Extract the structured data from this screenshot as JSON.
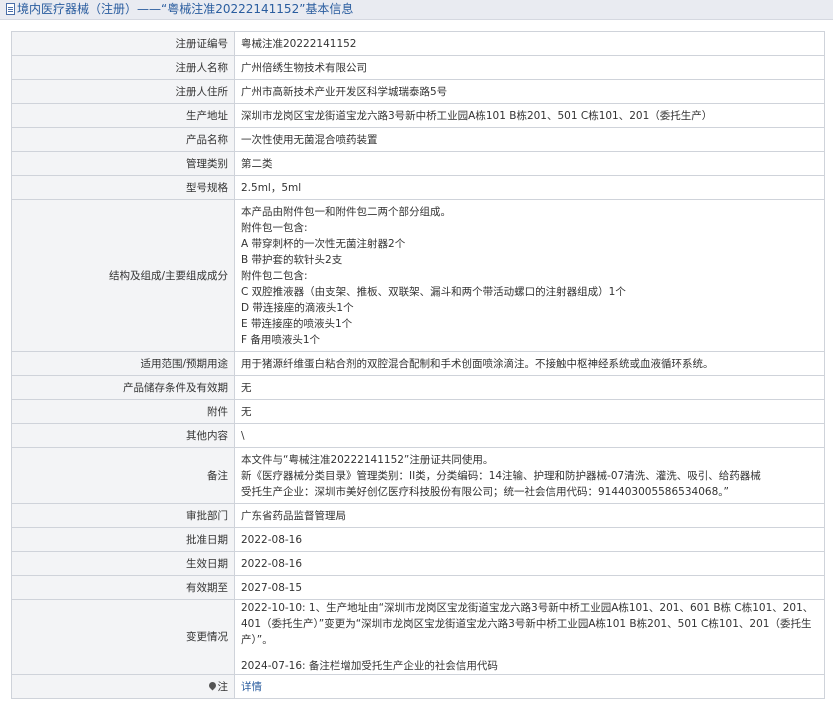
{
  "header": {
    "title": "境内医疗器械（注册）——“粤械注准20222141152”基本信息",
    "icon": "document-icon"
  },
  "rows": [
    {
      "label": "注册证编号",
      "value": "粤械注准20222141152"
    },
    {
      "label": "注册人名称",
      "value": "广州倍绣生物技术有限公司"
    },
    {
      "label": "注册人住所",
      "value": "广州市高新技术产业开发区科学城瑞泰路5号"
    },
    {
      "label": "生产地址",
      "value": "深圳市龙岗区宝龙街道宝龙六路3号新中桥工业园A栋101 B栋201、501 C栋101、201（委托生产）"
    },
    {
      "label": "产品名称",
      "value": "一次性使用无菌混合喷药装置"
    },
    {
      "label": "管理类别",
      "value": "第二类"
    },
    {
      "label": "型号规格",
      "value": "2.5ml，5ml"
    }
  ],
  "composition": {
    "label": "结构及组成/主要组成成分",
    "lines": [
      "本产品由附件包一和附件包二两个部分组成。",
      "附件包一包含:",
      "A 带穿刺杯的一次性无菌注射器2个",
      "B 带护套的软针头2支",
      "附件包二包含:",
      "C 双腔推液器（由支架、推板、双联架、漏斗和两个带活动螺口的注射器组成）1个",
      "D 带连接座的滴液头1个",
      "E 带连接座的喷液头1个",
      "F 备用喷液头1个"
    ]
  },
  "rows2": [
    {
      "label": "适用范围/预期用途",
      "value": "用于猪源纤维蛋白粘合剂的双腔混合配制和手术创面喷涂滴注。不接触中枢神经系统或血液循环系统。"
    },
    {
      "label": "产品储存条件及有效期",
      "value": "无"
    },
    {
      "label": "附件",
      "value": "无"
    },
    {
      "label": "其他内容",
      "value": "\\"
    }
  ],
  "remarks": {
    "label": "备注",
    "lines": [
      "本文件与“粤械注准20222141152”注册证共同使用。",
      "新《医疗器械分类目录》管理类别：II类，分类编码：14注输、护理和防护器械-07清洗、灌洗、吸引、给药器械",
      "受托生产企业：深圳市美好创亿医疗科技股份有限公司；统一社会信用代码：914403005586534068。”"
    ]
  },
  "rows3": [
    {
      "label": "审批部门",
      "value": "广东省药品监督管理局"
    },
    {
      "label": "批准日期",
      "value": "2022-08-16"
    },
    {
      "label": "生效日期",
      "value": "2022-08-16"
    },
    {
      "label": "有效期至",
      "value": "2027-08-15"
    }
  ],
  "changes": {
    "label": "变更情况",
    "entry1": "2022-10-10: 1、生产地址由“深圳市龙岗区宝龙街道宝龙六路3号新中桥工业园A栋101、201、601 B栋 C栋101、201、401（委托生产）”变更为“深圳市龙岗区宝龙街道宝龙六路3号新中桥工业园A栋101 B栋201、501 C栋101、201（委托生产）”。",
    "entry2": "2024-07-16: 备注栏增加受托生产企业的社会信用代码"
  },
  "note_row": {
    "label": "注",
    "icon": "pin-icon",
    "link": "详情"
  }
}
